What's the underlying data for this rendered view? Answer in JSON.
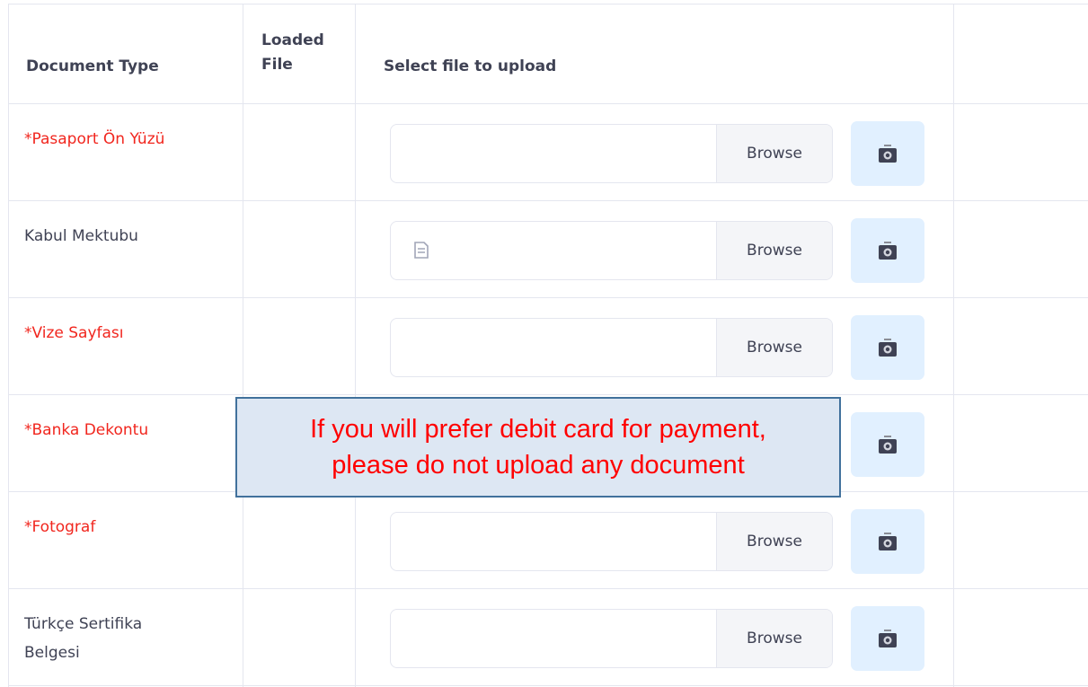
{
  "table": {
    "headers": {
      "document_type": "Document Type",
      "loaded_file_line1": "Loaded",
      "loaded_file_line2": "File",
      "select_file": "Select file to upload"
    },
    "browse_label": "Browse",
    "rows": [
      {
        "label": "*Pasaport Ön Yüzü",
        "required": true,
        "file_icon": false
      },
      {
        "label": "Kabul Mektubu",
        "required": false,
        "file_icon": true
      },
      {
        "label": "*Vize Sayfası",
        "required": true,
        "file_icon": false
      },
      {
        "label": "*Banka Dekontu",
        "required": true,
        "file_icon": false
      },
      {
        "label": "*Fotograf",
        "required": true,
        "file_icon": false
      },
      {
        "label_line1": "Türkçe Sertifika",
        "label_line2": "Belgesi",
        "required": false,
        "file_icon": false
      }
    ]
  },
  "notice": {
    "line1": "If you will prefer debit card for payment,",
    "line2": "please do not upload any document"
  },
  "colors": {
    "required_text": "#f1261e",
    "camera_button_bg": "#e1f0ff",
    "notice_bg": "#dde7f3",
    "notice_border": "#41719c",
    "notice_text": "#ff0000"
  },
  "icons": {
    "camera": "camera-icon",
    "file": "file-icon"
  }
}
